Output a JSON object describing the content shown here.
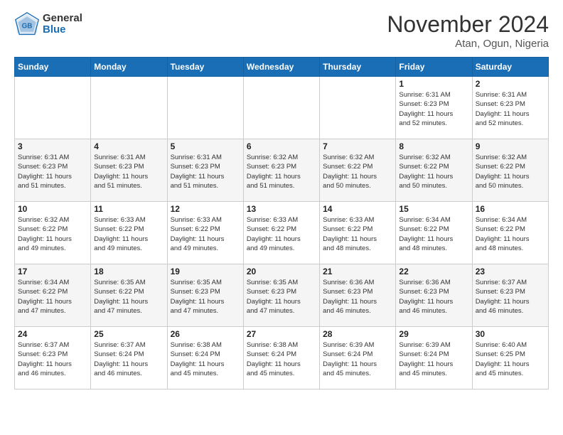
{
  "header": {
    "logo_general": "General",
    "logo_blue": "Blue",
    "month_title": "November 2024",
    "location": "Atan, Ogun, Nigeria"
  },
  "weekdays": [
    "Sunday",
    "Monday",
    "Tuesday",
    "Wednesday",
    "Thursday",
    "Friday",
    "Saturday"
  ],
  "rows": [
    [
      {
        "day": "",
        "info": ""
      },
      {
        "day": "",
        "info": ""
      },
      {
        "day": "",
        "info": ""
      },
      {
        "day": "",
        "info": ""
      },
      {
        "day": "",
        "info": ""
      },
      {
        "day": "1",
        "info": "Sunrise: 6:31 AM\nSunset: 6:23 PM\nDaylight: 11 hours\nand 52 minutes."
      },
      {
        "day": "2",
        "info": "Sunrise: 6:31 AM\nSunset: 6:23 PM\nDaylight: 11 hours\nand 52 minutes."
      }
    ],
    [
      {
        "day": "3",
        "info": "Sunrise: 6:31 AM\nSunset: 6:23 PM\nDaylight: 11 hours\nand 51 minutes."
      },
      {
        "day": "4",
        "info": "Sunrise: 6:31 AM\nSunset: 6:23 PM\nDaylight: 11 hours\nand 51 minutes."
      },
      {
        "day": "5",
        "info": "Sunrise: 6:31 AM\nSunset: 6:23 PM\nDaylight: 11 hours\nand 51 minutes."
      },
      {
        "day": "6",
        "info": "Sunrise: 6:32 AM\nSunset: 6:23 PM\nDaylight: 11 hours\nand 51 minutes."
      },
      {
        "day": "7",
        "info": "Sunrise: 6:32 AM\nSunset: 6:22 PM\nDaylight: 11 hours\nand 50 minutes."
      },
      {
        "day": "8",
        "info": "Sunrise: 6:32 AM\nSunset: 6:22 PM\nDaylight: 11 hours\nand 50 minutes."
      },
      {
        "day": "9",
        "info": "Sunrise: 6:32 AM\nSunset: 6:22 PM\nDaylight: 11 hours\nand 50 minutes."
      }
    ],
    [
      {
        "day": "10",
        "info": "Sunrise: 6:32 AM\nSunset: 6:22 PM\nDaylight: 11 hours\nand 49 minutes."
      },
      {
        "day": "11",
        "info": "Sunrise: 6:33 AM\nSunset: 6:22 PM\nDaylight: 11 hours\nand 49 minutes."
      },
      {
        "day": "12",
        "info": "Sunrise: 6:33 AM\nSunset: 6:22 PM\nDaylight: 11 hours\nand 49 minutes."
      },
      {
        "day": "13",
        "info": "Sunrise: 6:33 AM\nSunset: 6:22 PM\nDaylight: 11 hours\nand 49 minutes."
      },
      {
        "day": "14",
        "info": "Sunrise: 6:33 AM\nSunset: 6:22 PM\nDaylight: 11 hours\nand 48 minutes."
      },
      {
        "day": "15",
        "info": "Sunrise: 6:34 AM\nSunset: 6:22 PM\nDaylight: 11 hours\nand 48 minutes."
      },
      {
        "day": "16",
        "info": "Sunrise: 6:34 AM\nSunset: 6:22 PM\nDaylight: 11 hours\nand 48 minutes."
      }
    ],
    [
      {
        "day": "17",
        "info": "Sunrise: 6:34 AM\nSunset: 6:22 PM\nDaylight: 11 hours\nand 47 minutes."
      },
      {
        "day": "18",
        "info": "Sunrise: 6:35 AM\nSunset: 6:22 PM\nDaylight: 11 hours\nand 47 minutes."
      },
      {
        "day": "19",
        "info": "Sunrise: 6:35 AM\nSunset: 6:23 PM\nDaylight: 11 hours\nand 47 minutes."
      },
      {
        "day": "20",
        "info": "Sunrise: 6:35 AM\nSunset: 6:23 PM\nDaylight: 11 hours\nand 47 minutes."
      },
      {
        "day": "21",
        "info": "Sunrise: 6:36 AM\nSunset: 6:23 PM\nDaylight: 11 hours\nand 46 minutes."
      },
      {
        "day": "22",
        "info": "Sunrise: 6:36 AM\nSunset: 6:23 PM\nDaylight: 11 hours\nand 46 minutes."
      },
      {
        "day": "23",
        "info": "Sunrise: 6:37 AM\nSunset: 6:23 PM\nDaylight: 11 hours\nand 46 minutes."
      }
    ],
    [
      {
        "day": "24",
        "info": "Sunrise: 6:37 AM\nSunset: 6:23 PM\nDaylight: 11 hours\nand 46 minutes."
      },
      {
        "day": "25",
        "info": "Sunrise: 6:37 AM\nSunset: 6:24 PM\nDaylight: 11 hours\nand 46 minutes."
      },
      {
        "day": "26",
        "info": "Sunrise: 6:38 AM\nSunset: 6:24 PM\nDaylight: 11 hours\nand 45 minutes."
      },
      {
        "day": "27",
        "info": "Sunrise: 6:38 AM\nSunset: 6:24 PM\nDaylight: 11 hours\nand 45 minutes."
      },
      {
        "day": "28",
        "info": "Sunrise: 6:39 AM\nSunset: 6:24 PM\nDaylight: 11 hours\nand 45 minutes."
      },
      {
        "day": "29",
        "info": "Sunrise: 6:39 AM\nSunset: 6:24 PM\nDaylight: 11 hours\nand 45 minutes."
      },
      {
        "day": "30",
        "info": "Sunrise: 6:40 AM\nSunset: 6:25 PM\nDaylight: 11 hours\nand 45 minutes."
      }
    ]
  ]
}
